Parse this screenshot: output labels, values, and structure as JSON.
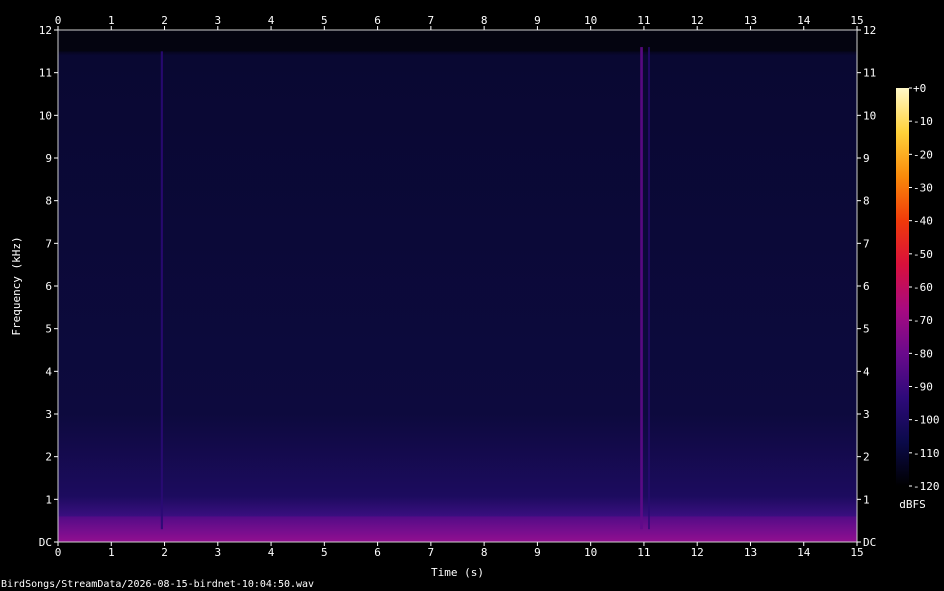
{
  "chart_data": {
    "type": "heatmap",
    "xlabel": "Time (s)",
    "ylabel": "Frequency (kHz)",
    "xlim": [
      0,
      15
    ],
    "ylim": [
      0,
      12
    ],
    "x_ticks": [
      "0",
      "1",
      "2",
      "3",
      "4",
      "5",
      "6",
      "7",
      "8",
      "9",
      "10",
      "11",
      "12",
      "13",
      "14",
      "15"
    ],
    "y_ticks": [
      "DC",
      "1",
      "2",
      "3",
      "4",
      "5",
      "6",
      "7",
      "8",
      "9",
      "10",
      "11",
      "12"
    ],
    "colorbar": {
      "label": "dBFS",
      "ticks": [
        "+0",
        "-10",
        "-20",
        "-30",
        "-40",
        "-50",
        "-60",
        "-70",
        "-80",
        "-90",
        "-100",
        "-110",
        "-120"
      ],
      "range": [
        -120,
        0
      ],
      "stops": [
        "#000000",
        "#0b0a4a",
        "#2e0a7a",
        "#6a0a8c",
        "#a80a80",
        "#d8103c",
        "#f03a0a",
        "#fa8a0a",
        "#ffd23a",
        "#fff8c8"
      ]
    },
    "events": [
      {
        "t_start": 1.93,
        "t_end": 1.97,
        "f_low": 0.3,
        "f_high": 11.5,
        "level_db": -95
      },
      {
        "t_start": 10.93,
        "t_end": 10.98,
        "f_low": 0.3,
        "f_high": 11.6,
        "level_db": -82
      },
      {
        "t_start": 11.08,
        "t_end": 11.11,
        "f_low": 0.3,
        "f_high": 11.6,
        "level_db": -95
      }
    ],
    "noise_floor_db": -113,
    "low_band": {
      "f_low": 0,
      "f_high": 0.6,
      "level_db": -80
    },
    "content_top_khz": 11.5
  },
  "footer": {
    "source_file": "BirdSongs/StreamData/2026-08-15-birdnet-10:04:50.wav"
  }
}
